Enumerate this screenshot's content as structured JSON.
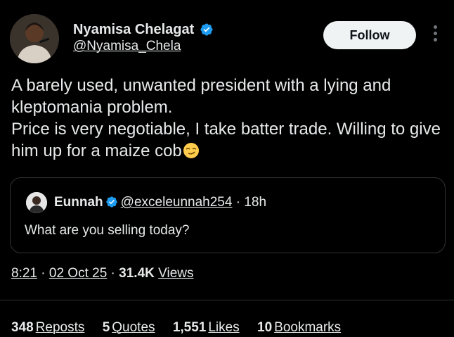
{
  "author": {
    "display_name": "Nyamisa Chelagat",
    "handle": "@Nyamisa_Chela",
    "verified": true,
    "avatar": "profile-photo"
  },
  "follow_button": {
    "label": "Follow"
  },
  "more_icon": "more-vertical-icon",
  "tweet": {
    "lines": [
      "A barely used, unwanted president with a lying and kleptomania problem.",
      "Price is very negotiable, I take batter trade. Willing to give him up for a maize cob"
    ],
    "emoji": "smirking-face-emoji"
  },
  "quoted_tweet": {
    "name": "Eunnah",
    "verified": true,
    "handle": "@exceleunnah254",
    "separator": "·",
    "time_ago": "18h",
    "text": "What are you selling today?"
  },
  "meta": {
    "time": "8:21",
    "separator": "·",
    "date": "02 Oct 25",
    "views_count": "31.4K",
    "views_label": "Views"
  },
  "stats": [
    {
      "count": "348",
      "label": "Reposts"
    },
    {
      "count": "5",
      "label": "Quotes"
    },
    {
      "count": "1,551",
      "label": "Likes"
    },
    {
      "count": "10",
      "label": "Bookmarks"
    }
  ],
  "colors": {
    "background": "#000000",
    "text": "#e7e9ea",
    "verified_blue": "#1d9bf0",
    "follow_bg": "#eff3f4",
    "border": "#2f3336"
  }
}
